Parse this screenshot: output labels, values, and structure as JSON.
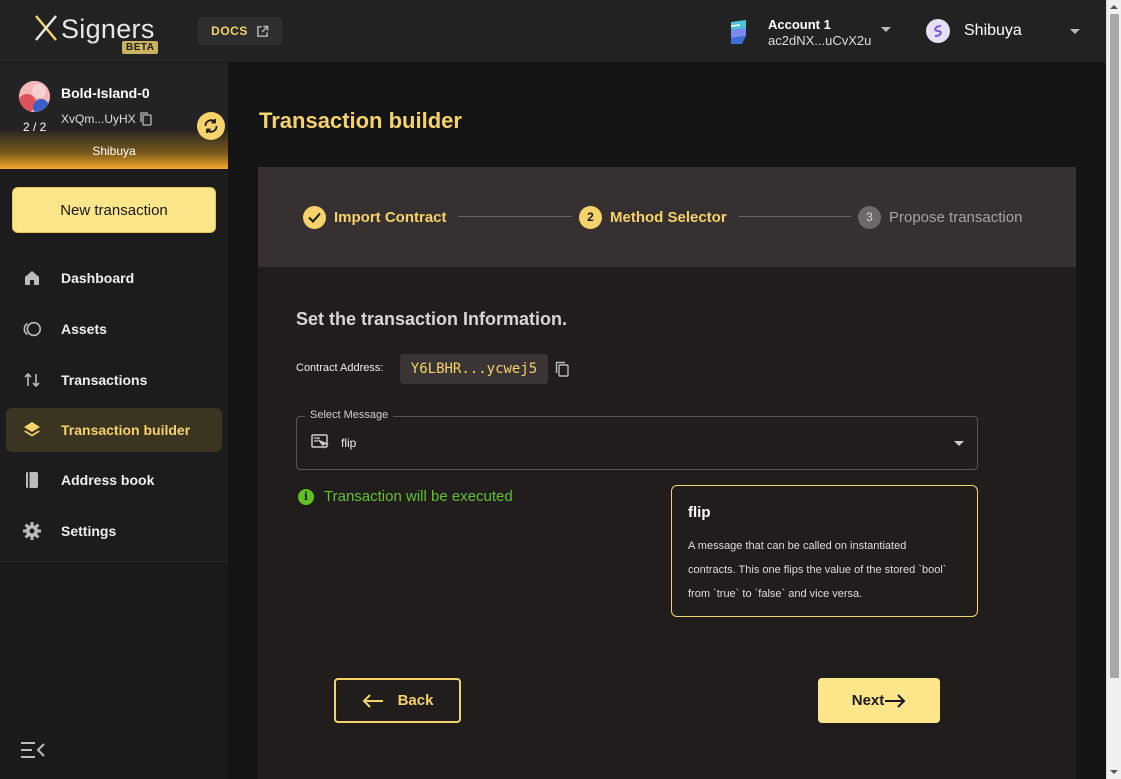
{
  "app": {
    "logo_text": "Signers",
    "logo_badge": "BETA",
    "docs_label": "DOCS"
  },
  "account": {
    "name": "Account 1",
    "address": "ac2dNX...uCvX2u"
  },
  "network": {
    "name": "Shibuya"
  },
  "safe": {
    "name": "Bold-Island-0",
    "address": "XvQm...UyHX",
    "threshold": "2 / 2",
    "network": "Shibuya"
  },
  "sidebar": {
    "new_transaction": "New transaction",
    "items": [
      {
        "label": "Dashboard",
        "icon": "home-icon"
      },
      {
        "label": "Assets",
        "icon": "coins-icon"
      },
      {
        "label": "Transactions",
        "icon": "arrows-updown-icon"
      },
      {
        "label": "Transaction builder",
        "icon": "layers-icon",
        "active": true
      },
      {
        "label": "Address book",
        "icon": "book-icon"
      },
      {
        "label": "Settings",
        "icon": "gear-icon"
      }
    ]
  },
  "page": {
    "title": "Transaction builder"
  },
  "stepper": {
    "steps": [
      {
        "number": "1",
        "label": "Import Contract",
        "state": "completed"
      },
      {
        "number": "2",
        "label": "Method Selector",
        "state": "active"
      },
      {
        "number": "3",
        "label": "Propose transaction",
        "state": "pending"
      }
    ]
  },
  "form": {
    "section_title": "Set the transaction Information.",
    "contract_label": "Contract Address:",
    "contract_address": "Y6LBHR...ycwej5",
    "select_label": "Select Message",
    "selected_message": "flip",
    "exec_status": "Transaction will be executed"
  },
  "message_info": {
    "title": "flip",
    "description": "A message that can be called on instantiated contracts. This one flips the value of the stored `bool` from `true` to `false` and vice versa."
  },
  "actions": {
    "back": "Back",
    "next": "Next"
  },
  "colors": {
    "accent": "#f5d36a",
    "button_bg": "#fde58a",
    "success": "#62c22e"
  }
}
